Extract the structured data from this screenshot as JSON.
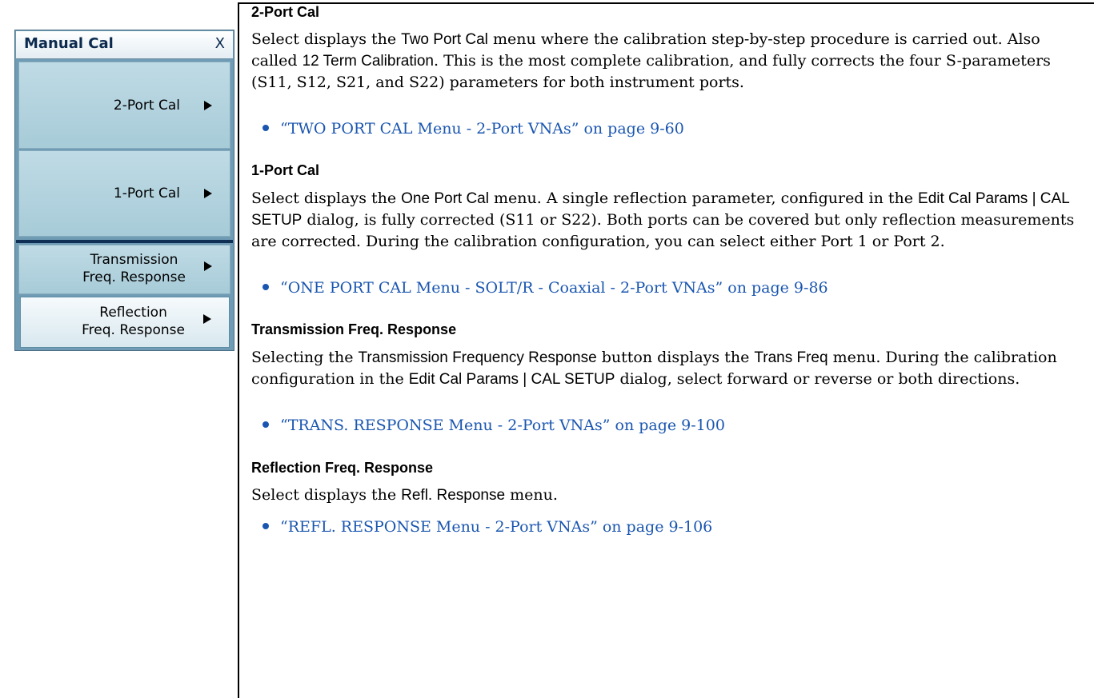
{
  "menu": {
    "title": "Manual Cal",
    "close": "X",
    "buttons": [
      {
        "line1": "2-Port Cal",
        "line2": ""
      },
      {
        "line1": "1-Port Cal",
        "line2": ""
      },
      {
        "line1": "Transmission",
        "line2": "Freq. Response"
      },
      {
        "line1": "Reflection",
        "line2": "Freq. Response"
      }
    ]
  },
  "sections": [
    {
      "heading": "2-Port Cal",
      "body": [
        {
          "t": "Select displays the ",
          "s": false
        },
        {
          "t": "Two Port Cal",
          "s": true
        },
        {
          "t": " menu where the calibration step-by-step procedure is carried out. Also called ",
          "s": false
        },
        {
          "t": "12 Term Calibration",
          "s": true
        },
        {
          "t": ". This is the most complete calibration, and fully corrects the four S-parameters (S11, S12, S21, and S22) parameters for both instrument ports.",
          "s": false
        }
      ],
      "link": "“TWO PORT CAL Menu - 2-Port VNAs” on page 9-60"
    },
    {
      "heading": "1-Port Cal",
      "body": [
        {
          "t": "Select displays the ",
          "s": false
        },
        {
          "t": "One Port Cal",
          "s": true
        },
        {
          "t": " menu. A single reflection parameter, configured in the ",
          "s": false
        },
        {
          "t": "Edit Cal Params | CAL SETUP",
          "s": true
        },
        {
          "t": " dialog, is fully corrected (S11 or S22). Both ports can be covered but only reflection measurements are corrected. During the calibration configuration, you can select either Port 1 or Port 2.",
          "s": false
        }
      ],
      "link": "“ONE PORT CAL Menu - SOLT/R - Coaxial - 2-Port VNAs” on page 9-86"
    },
    {
      "heading": "Transmission Freq. Response",
      "body": [
        {
          "t": "Selecting the ",
          "s": false
        },
        {
          "t": "Transmission Frequency Response",
          "s": true
        },
        {
          "t": " button displays the ",
          "s": false
        },
        {
          "t": "Trans Freq",
          "s": true
        },
        {
          "t": " menu. During the calibration configuration in the ",
          "s": false
        },
        {
          "t": "Edit Cal Params | CAL SETUP",
          "s": true
        },
        {
          "t": " dialog, select forward or reverse or both directions.",
          "s": false
        }
      ],
      "link": "“TRANS. RESPONSE Menu - 2-Port VNAs” on page 9-100"
    },
    {
      "heading": "Reflection Freq. Response",
      "body": [
        {
          "t": "Select displays the ",
          "s": false
        },
        {
          "t": "Refl. Response",
          "s": true
        },
        {
          "t": " menu.",
          "s": false
        }
      ],
      "link": "“REFL. RESPONSE Menu - 2-Port VNAs” on page 9-106"
    }
  ]
}
